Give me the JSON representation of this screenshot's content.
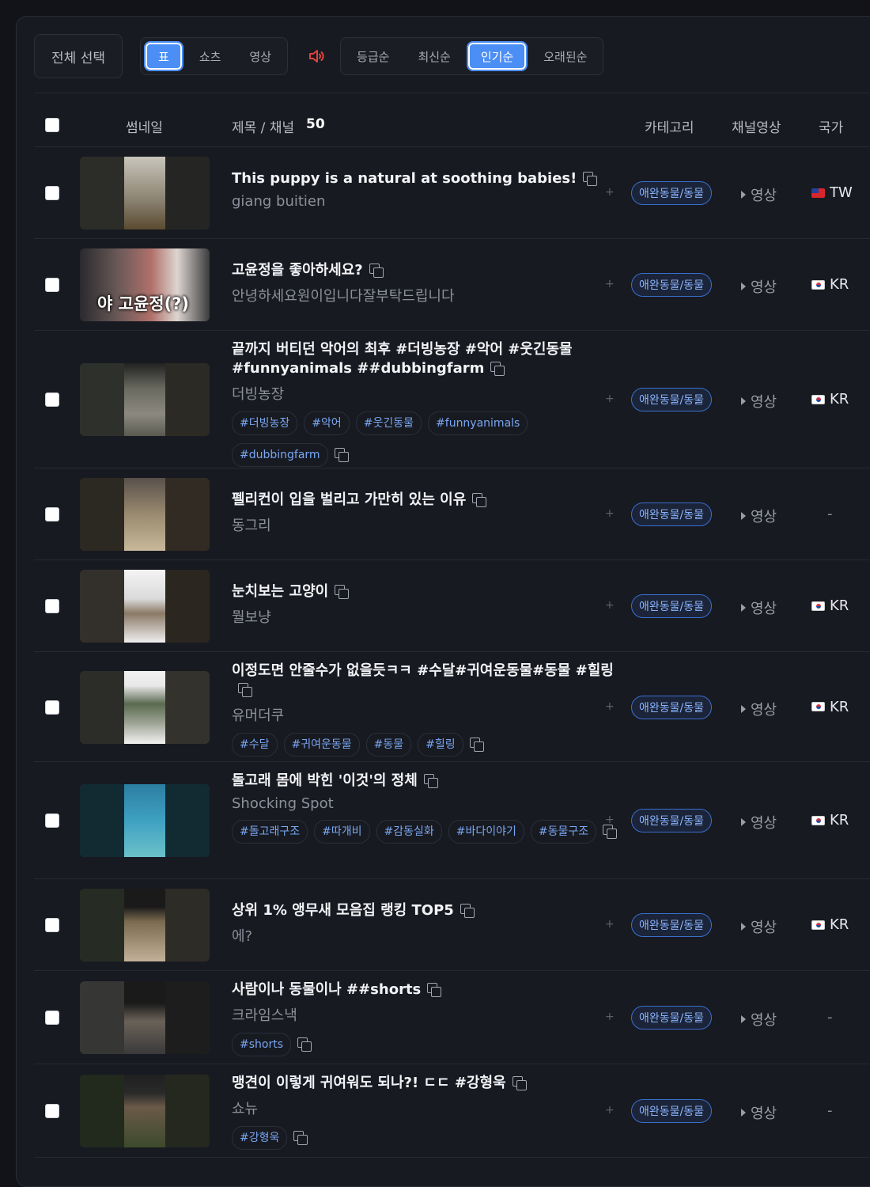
{
  "toolbar": {
    "select_all": "전체 선택",
    "view_modes": [
      "표",
      "쇼츠",
      "영상"
    ],
    "active_view": "표",
    "sort_options": [
      "등급순",
      "최신순",
      "인기순",
      "오래된순"
    ],
    "active_sort": "인기순",
    "speaker_icon": "speaker-icon",
    "accent": "#4b8ef5"
  },
  "table": {
    "headers": {
      "thumbnail": "썸네일",
      "title_channel": "제목 / 채널",
      "count": "50",
      "category": "카테고리",
      "channel_video": "채널영상",
      "country": "국가"
    },
    "rows": [
      {
        "title": "This puppy is a natural at soothing babies!",
        "channel": "giang buitien",
        "tags": [],
        "category": "애완동물/동물",
        "video": "영상",
        "country": "TW",
        "flag": "tw"
      },
      {
        "title": "고윤정을 좋아하세요?",
        "channel": "안녕하세요원이입니다잘부탁드립니다",
        "tags": [],
        "category": "애완동물/동물",
        "video": "영상",
        "country": "KR",
        "flag": "kr",
        "thumb_text": "야 고윤정(?)"
      },
      {
        "title": "끝까지 버티던 악어의 최후 #더빙농장 #악어 #웃긴동물 #funnyanimals ##dubbingfarm",
        "channel": "더빙농장",
        "tags": [
          "#더빙농장",
          "#악어",
          "#웃긴동물",
          "#funnyanimals",
          "#dubbingfarm"
        ],
        "category": "애완동물/동물",
        "video": "영상",
        "country": "KR",
        "flag": "kr"
      },
      {
        "title": "펠리컨이 입을 벌리고 가만히 있는 이유",
        "channel": "동그리",
        "tags": [],
        "category": "애완동물/동물",
        "video": "영상",
        "country": "-",
        "flag": ""
      },
      {
        "title": "눈치보는 고양이",
        "channel": "뭘보냥",
        "tags": [],
        "category": "애완동물/동물",
        "video": "영상",
        "country": "KR",
        "flag": "kr"
      },
      {
        "title": "이정도면 안줄수가 없을듯ㅋㅋ #수달#귀여운동물#동물 #힐링",
        "channel": "유머더쿠",
        "tags": [
          "#수달",
          "#귀여운동물",
          "#동물",
          "#힐링"
        ],
        "category": "애완동물/동물",
        "video": "영상",
        "country": "KR",
        "flag": "kr"
      },
      {
        "title": "돌고래 몸에 박힌 '이것'의 정체",
        "channel": "Shocking Spot",
        "tags": [
          "#돌고래구조",
          "#따개비",
          "#감동실화",
          "#바다이야기",
          "#동물구조"
        ],
        "category": "애완동물/동물",
        "video": "영상",
        "country": "KR",
        "flag": "kr"
      },
      {
        "title": "상위 1% 앵무새 모음집 랭킹 TOP5",
        "channel": "에?",
        "tags": [],
        "category": "애완동물/동물",
        "video": "영상",
        "country": "KR",
        "flag": "kr"
      },
      {
        "title": "사람이나 동물이나 ##shorts",
        "channel": "크라임스낵",
        "tags": [
          "#shorts"
        ],
        "category": "애완동물/동물",
        "video": "영상",
        "country": "-",
        "flag": ""
      },
      {
        "title": "맹견이 이렇게 귀여워도 되나?! ㄷㄷ #강형욱",
        "channel": "쇼뉴",
        "tags": [
          "#강형욱"
        ],
        "category": "애완동물/동물",
        "video": "영상",
        "country": "-",
        "flag": ""
      }
    ]
  }
}
